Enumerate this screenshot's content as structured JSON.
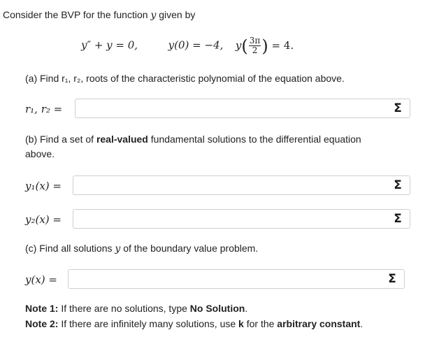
{
  "intro": {
    "text": "Consider the BVP for the function",
    "var": "y",
    "tail": "given by"
  },
  "equation": {
    "ode": "y″ + y = 0,",
    "bc1": "y(0) = −4,",
    "bc2_prefix": "y",
    "bc2_num": "3π",
    "bc2_den": "2",
    "bc2_suffix": "= 4."
  },
  "part_a": {
    "question": "(a) Find r₁, r₂, roots of the characteristic polynomial of the equation above.",
    "label": "r₁, r₂ =",
    "value": ""
  },
  "part_b": {
    "question_pre": "(b) Find a set of ",
    "question_bold": "real-valued",
    "question_post": " fundamental solutions to the differential equation",
    "question_line2": "above.",
    "y1_label": "y₁(x) =",
    "y2_label": "y₂(x) =",
    "y1_value": "",
    "y2_value": ""
  },
  "part_c": {
    "question_pre": "(c) Find all solutions ",
    "question_var": "y",
    "question_post": " of the boundary value problem.",
    "label": "y(x) =",
    "value": ""
  },
  "notes": {
    "note1_label": "Note 1:",
    "note1_pre": " If there are no solutions, type ",
    "note1_bold": "No Solution",
    "note1_post": ".",
    "note2_label": "Note 2:",
    "note2_pre": " If there are infinitely many solutions, use ",
    "note2_bold1": "k",
    "note2_mid": " for the ",
    "note2_bold2": "arbitrary constant",
    "note2_post": "."
  },
  "icons": {
    "sigma": "Σ"
  }
}
